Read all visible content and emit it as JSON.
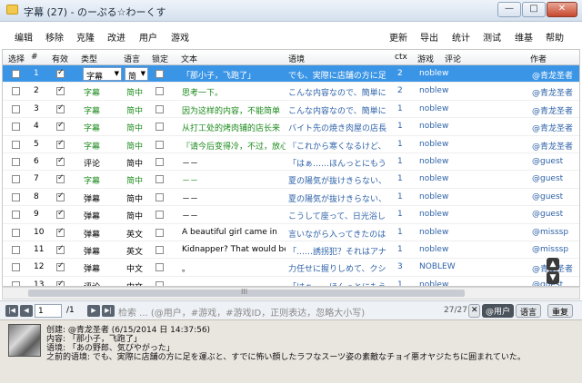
{
  "window": {
    "title": "字幕 (27) - のーぷる☆わーくす",
    "minimize": "—",
    "maximize": "□",
    "close": "✕"
  },
  "toolbar": {
    "left": [
      "编辑",
      "移除",
      "克隆",
      "改进",
      "用户",
      "游戏"
    ],
    "right": [
      "更新",
      "导出",
      "统计",
      "测试",
      "维基",
      "帮助"
    ]
  },
  "table": {
    "headers": [
      "选择",
      "#",
      "有效",
      "类型",
      "语言",
      "锁定",
      "文本",
      "语境",
      "ctx",
      "游戏",
      "评论",
      "作者"
    ],
    "rows": [
      {
        "num": "1",
        "valid": true,
        "type": "字幕",
        "lang": "简",
        "text": "「那小子，飞跑了」",
        "context": "でも、実際に店舗の方に足",
        "ctx": "2",
        "game": "noblew",
        "author": "@青龙圣者",
        "selected": true
      },
      {
        "num": "2",
        "valid": true,
        "type": "字幕",
        "lang": "简中",
        "text": "思考一下。",
        "context": "こんな内容なので、簡単に",
        "ctx": "2",
        "game": "noblew",
        "author": "@青龙圣者"
      },
      {
        "num": "3",
        "valid": true,
        "type": "字幕",
        "lang": "简中",
        "text": "因为这样的内容，不能简单",
        "context": "こんな内容なので、簡単に",
        "ctx": "1",
        "game": "noblew",
        "author": "@青龙圣者"
      },
      {
        "num": "4",
        "valid": true,
        "type": "字幕",
        "lang": "简中",
        "text": "从打工处的烤肉铺的店长来",
        "context": "バイト先の焼き肉屋の店長",
        "ctx": "1",
        "game": "noblew",
        "author": "@青龙圣者"
      },
      {
        "num": "5",
        "valid": true,
        "type": "字幕",
        "lang": "简中",
        "text": "『请今后变得冷，不过，放心",
        "context": "『これから寒くなるけど、",
        "ctx": "1",
        "game": "noblew",
        "author": "@青龙圣者"
      },
      {
        "num": "6",
        "valid": true,
        "type": "评论",
        "lang": "简中",
        "text": "－－",
        "context": "「はぁ……ほんっとにもう",
        "ctx": "1",
        "game": "noblew",
        "author": "@guest"
      },
      {
        "num": "7",
        "valid": true,
        "type": "字幕",
        "lang": "简中",
        "text": "－－",
        "context": "夏の陽気が抜けきらない、",
        "ctx": "1",
        "game": "noblew",
        "author": "@guest"
      },
      {
        "num": "8",
        "valid": true,
        "type": "弹幕",
        "lang": "简中",
        "text": "－－",
        "context": "夏の陽気が抜けきらない、",
        "ctx": "1",
        "game": "noblew",
        "author": "@guest"
      },
      {
        "num": "9",
        "valid": true,
        "type": "弹幕",
        "lang": "简中",
        "text": "－－",
        "context": "こうして座って、日光浴し",
        "ctx": "1",
        "game": "noblew",
        "author": "@guest"
      },
      {
        "num": "10",
        "valid": true,
        "type": "弹幕",
        "lang": "英文",
        "text": "A beautiful girl came in",
        "context": "言いながら入ってきたのは",
        "ctx": "1",
        "game": "noblew",
        "author": "@misssp"
      },
      {
        "num": "11",
        "valid": true,
        "type": "弹幕",
        "lang": "英文",
        "text": "Kidnapper? That would be",
        "context": "「……誘拐犯？それはアナ",
        "ctx": "1",
        "game": "noblew",
        "author": "@misssp"
      },
      {
        "num": "12",
        "valid": true,
        "type": "弹幕",
        "lang": "中文",
        "text": "。",
        "context": "力任せに握りしめて、クシ",
        "ctx": "3",
        "game": "NOBLEW",
        "author": "@青龙圣者"
      },
      {
        "num": "13",
        "valid": true,
        "type": "评论",
        "lang": "中文",
        "text": "。",
        "context": "「はぁ……ほんっとにもう",
        "ctx": "1",
        "game": "noblew",
        "author": "@guest"
      }
    ]
  },
  "hscroll": {
    "grip": "III"
  },
  "float_buttons": {
    "up": "▲",
    "down": "▼"
  },
  "nav": {
    "first": "|◀",
    "prev": "◀",
    "page_value": "1",
    "page_total": "/1",
    "next": "▶",
    "last": "▶|",
    "search_placeholder": "检索 ... (@用户，#游戏，#游戏ID，正则表达，忽略大小写)",
    "count": "27/27",
    "clear": "✕",
    "user_filter": "@用户",
    "lang_filter": "语言",
    "reset": "重复"
  },
  "info": {
    "created": "创建: @青龙圣者 (6/15/2014 日 14:37:56)",
    "content": "内容: 「那小子，飞跑了」",
    "context": "语境: 「あの野郎、気びやがった」",
    "previous_context": "之前的语境: でも、実際に店舗の方に足を運ぶと、すでに怖い顔したラフなスーツ姿の素敵なチョイ悪オヤジたちに囲まれていた。"
  }
}
